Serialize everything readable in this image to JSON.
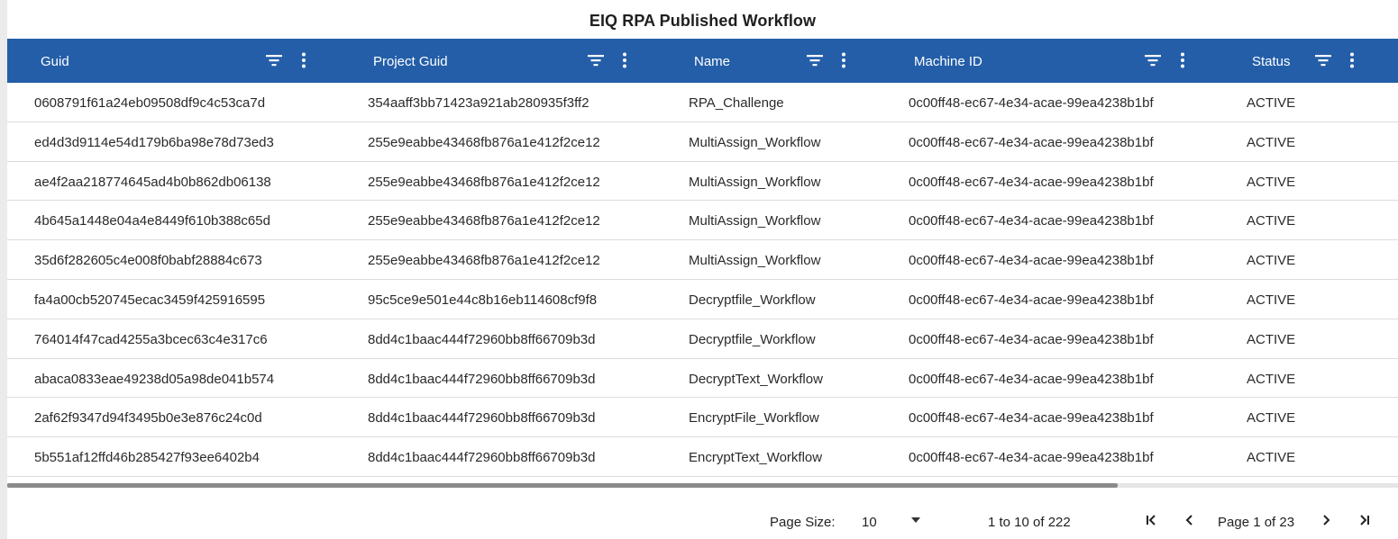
{
  "title": "EIQ RPA Published Workflow",
  "columns": [
    {
      "label": "Guid"
    },
    {
      "label": "Project Guid"
    },
    {
      "label": "Name"
    },
    {
      "label": "Machine ID"
    },
    {
      "label": "Status"
    }
  ],
  "rows": [
    [
      "0608791f61a24eb09508df9c4c53ca7d",
      "354aaff3bb71423a921ab280935f3ff2",
      "RPA_Challenge",
      "0c00ff48-ec67-4e34-acae-99ea4238b1bf",
      "ACTIVE"
    ],
    [
      "ed4d3d9114e54d179b6ba98e78d73ed3",
      "255e9eabbe43468fb876a1e412f2ce12",
      "MultiAssign_Workflow",
      "0c00ff48-ec67-4e34-acae-99ea4238b1bf",
      "ACTIVE"
    ],
    [
      "ae4f2aa218774645ad4b0b862db06138",
      "255e9eabbe43468fb876a1e412f2ce12",
      "MultiAssign_Workflow",
      "0c00ff48-ec67-4e34-acae-99ea4238b1bf",
      "ACTIVE"
    ],
    [
      "4b645a1448e04a4e8449f610b388c65d",
      "255e9eabbe43468fb876a1e412f2ce12",
      "MultiAssign_Workflow",
      "0c00ff48-ec67-4e34-acae-99ea4238b1bf",
      "ACTIVE"
    ],
    [
      "35d6f282605c4e008f0babf28884c673",
      "255e9eabbe43468fb876a1e412f2ce12",
      "MultiAssign_Workflow",
      "0c00ff48-ec67-4e34-acae-99ea4238b1bf",
      "ACTIVE"
    ],
    [
      "fa4a00cb520745ecac3459f425916595",
      "95c5ce9e501e44c8b16eb114608cf9f8",
      "Decryptfile_Workflow",
      "0c00ff48-ec67-4e34-acae-99ea4238b1bf",
      "ACTIVE"
    ],
    [
      "764014f47cad4255a3bcec63c4e317c6",
      "8dd4c1baac444f72960bb8ff66709b3d",
      "Decryptfile_Workflow",
      "0c00ff48-ec67-4e34-acae-99ea4238b1bf",
      "ACTIVE"
    ],
    [
      "abaca0833eae49238d05a98de041b574",
      "8dd4c1baac444f72960bb8ff66709b3d",
      "DecryptText_Workflow",
      "0c00ff48-ec67-4e34-acae-99ea4238b1bf",
      "ACTIVE"
    ],
    [
      "2af62f9347d94f3495b0e3e876c24c0d",
      "8dd4c1baac444f72960bb8ff66709b3d",
      "EncryptFile_Workflow",
      "0c00ff48-ec67-4e34-acae-99ea4238b1bf",
      "ACTIVE"
    ],
    [
      "5b551af12ffd46b285427f93ee6402b4",
      "8dd4c1baac444f72960bb8ff66709b3d",
      "EncryptText_Workflow",
      "0c00ff48-ec67-4e34-acae-99ea4238b1bf",
      "ACTIVE"
    ]
  ],
  "pagination": {
    "page_size_label": "Page Size:",
    "page_size_value": "10",
    "range_text": "1 to 10 of 222",
    "page_text": "Page 1 of 23"
  },
  "icons": {
    "filter": "filter-icon",
    "column_menu": "column-menu-icon",
    "first_page": "first-page-icon",
    "previous_page": "previous-page-icon",
    "next_page": "next-page-icon",
    "last_page": "last-page-icon",
    "dropdown": "chevron-down-icon"
  },
  "colors": {
    "header_bg": "#245ea8",
    "header_text": "#ffffff",
    "row_border": "#dcdcdc",
    "scrollbar_thumb": "#8a8a8a"
  }
}
